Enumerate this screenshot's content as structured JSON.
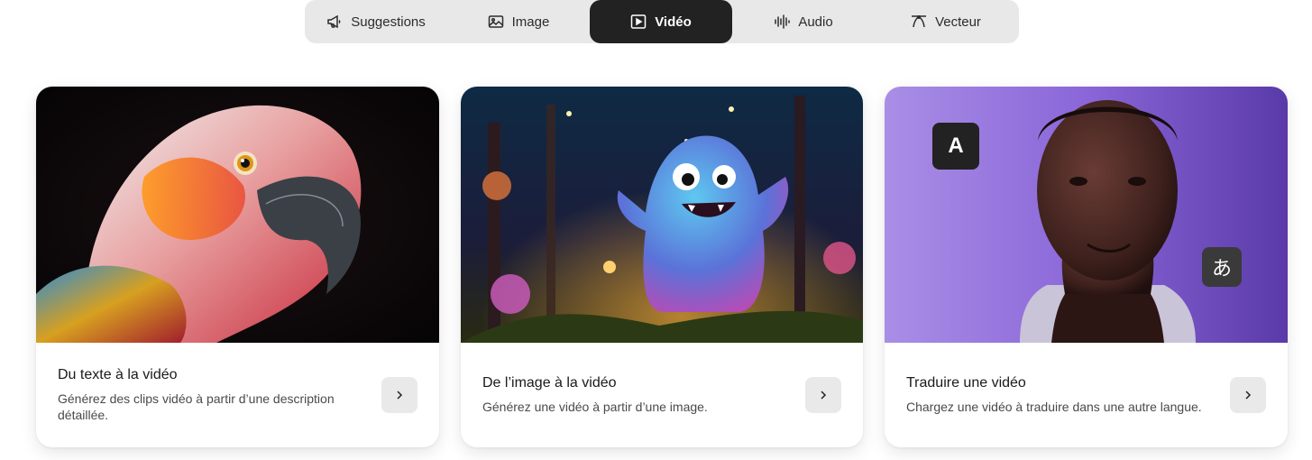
{
  "tabs": [
    {
      "label": "Suggestions",
      "icon": "megaphone-icon"
    },
    {
      "label": "Image",
      "icon": "image-icon"
    },
    {
      "label": "Vidéo",
      "icon": "video-play-icon",
      "active": true
    },
    {
      "label": "Audio",
      "icon": "waveform-icon"
    },
    {
      "label": "Vecteur",
      "icon": "vector-curve-icon"
    }
  ],
  "cards": [
    {
      "title": "Du texte à la vidéo",
      "description": "Générez des clips vidéo à partir d’une description détaillée.",
      "media": "parrot-photo"
    },
    {
      "title": "De l’image à la vidéo",
      "description": "Générez une vidéo à partir d’une image.",
      "media": "fluffy-monster-photo"
    },
    {
      "title": "Traduire une vidéo",
      "description": "Chargez une vidéo à traduire dans une autre langue.",
      "media": "man-portrait-photo",
      "bubbles": {
        "source": "A",
        "target": "あ"
      }
    }
  ],
  "colors": {
    "active_tab_bg": "#222222",
    "tabbar_bg": "#e8e8e8",
    "arrow_btn_bg": "#e9e9e9"
  }
}
